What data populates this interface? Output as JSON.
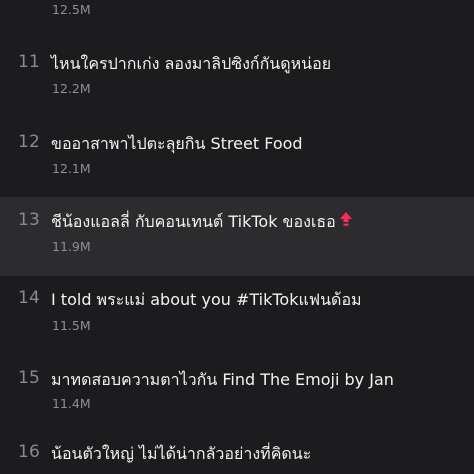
{
  "rows": [
    {
      "views": "12.5M"
    },
    {
      "rank": "11",
      "title": "ไหนใครปากเก่ง ลองมาลิปซิงก์กันดูหน่อย",
      "views": "12.2M"
    },
    {
      "rank": "12",
      "title": "ขออาสาพาไปตะลุยกิน Street Food",
      "views": "12.1M"
    },
    {
      "rank": "13",
      "title": "ชีน้องแอลลี่ กับคอนเทนต์ TikTok ของเธอ",
      "views": "11.9M",
      "trend_icon": "arrow-up-icon",
      "trend_color": "#fe2c55"
    },
    {
      "rank": "14",
      "title": "I told พระแม่ about you #TikTokแฟนด้อม",
      "views": "11.5M"
    },
    {
      "rank": "15",
      "title": "มาทดสอบความตาไวกัน Find The Emoji by Jan",
      "views": "11.4M"
    },
    {
      "rank": "16",
      "title": "น้อนตัวใหญ่ ไม่ได้น่ากลัวอย่างที่คิดนะ"
    }
  ],
  "colors": {
    "background": "#1c1c1e",
    "highlight_row": "#2c2c2e",
    "title_text": "#f2f2f2",
    "secondary_text": "#8e8e93",
    "trend_up": "#fe2c55"
  }
}
